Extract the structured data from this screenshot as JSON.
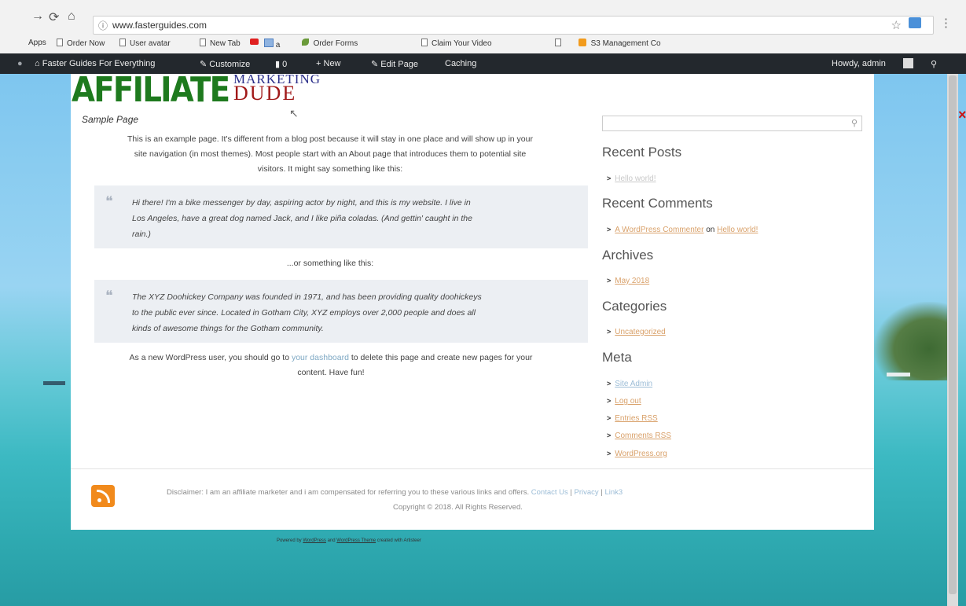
{
  "browser": {
    "url": "www.fasterguides.com",
    "bookmarks": [
      "Apps",
      "Order Now",
      "User avatar",
      "New Tab",
      "a",
      "Order Forms",
      "Claim Your Video",
      "S3 Management Co"
    ]
  },
  "adminbar": {
    "site": "Faster Guides For Everything",
    "customize": "Customize",
    "comments_count": "0",
    "new": "New",
    "edit_page": "Edit Page",
    "caching": "Caching",
    "howdy": "Howdy, admin"
  },
  "logo": {
    "line1": "AFFILIATE",
    "line2": "MARKETING",
    "line3": "DUDE"
  },
  "content": {
    "title": "Sample Page",
    "intro": [
      "This is an example page. It's different from a blog post because it will stay in one place and will show up in your",
      "site navigation (in most themes). Most people start with an About page that introduces them to potential site",
      "visitors. It might say something like this:"
    ],
    "quote1": [
      "Hi there! I'm a bike messenger by day, aspiring actor by night, and this is my website. I live in",
      "Los Angeles, have a great dog named Jack, and I like piña coladas. (And gettin' caught in the",
      "rain.)"
    ],
    "between": "...or something like this:",
    "quote2": [
      "The XYZ Doohickey Company was founded in 1971, and has been providing quality doohickeys",
      "to the public ever since. Located in Gotham City, XYZ employs over 2,000 people and does all",
      "kinds of awesome things for the Gotham community."
    ],
    "outro_pre": "As a new WordPress user, you should go to ",
    "outro_link": "your dashboard",
    "outro_post": " to delete this page and create new pages for your",
    "outro_line2": "content. Have fun!"
  },
  "sidebar": {
    "recent_posts_title": "Recent Posts",
    "recent_posts": [
      "Hello world!"
    ],
    "recent_comments_title": "Recent Comments",
    "comment_author": "A WordPress Commenter",
    "comment_on": "on",
    "comment_post": "Hello world!",
    "archives_title": "Archives",
    "archives": [
      "May 2018"
    ],
    "categories_title": "Categories",
    "categories": [
      "Uncategorized"
    ],
    "meta_title": "Meta",
    "meta": [
      "Site Admin",
      "Log out",
      "Entries RSS",
      "Comments RSS",
      "WordPress.org"
    ]
  },
  "footer": {
    "disclaimer": "Disclaimer: I am an affiliate marketer and i am compensated for referring you to these various links and offers.",
    "links": [
      "Contact Us",
      "Privacy",
      "Link3"
    ],
    "copyright": "Copyright © 2018. All Rights Reserved.",
    "powered_pre": "Powered by ",
    "powered_link1": "WordPress",
    "powered_mid": " and ",
    "powered_link2": "WordPress Theme",
    "powered_post": " created with Artisteer"
  }
}
